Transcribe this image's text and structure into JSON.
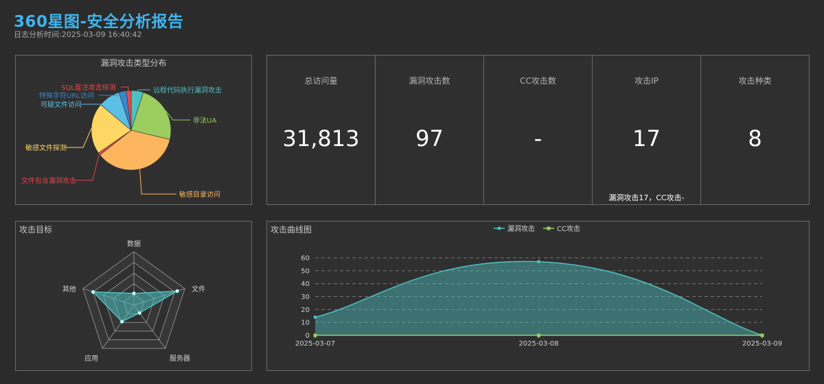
{
  "header": {
    "title": "360星图-安全分析报告",
    "subtitle": "日志分析时间:2025-03-09 16:40:42"
  },
  "pie": {
    "title": "漏洞攻击类型分布",
    "slices": [
      {
        "label": "远程代码执行漏洞攻击",
        "value": 5,
        "color": "#4fc1c1"
      },
      {
        "label": "非法UA",
        "value": 24,
        "color": "#9bcd5f"
      },
      {
        "label": "敏感目录访问",
        "value": 36,
        "color": "#fdb65e"
      },
      {
        "label": "文件包含漏洞攻击",
        "value": 1,
        "color": "#e0434f"
      },
      {
        "label": "敏感文件探测",
        "value": 21,
        "color": "#fdd664"
      },
      {
        "label": "可疑文件访问",
        "value": 9,
        "color": "#5cbfe5"
      },
      {
        "label": "特殊字符URL访问",
        "value": 3,
        "color": "#3a86c8"
      },
      {
        "label": "SQL盲注攻击探测",
        "value": 2,
        "color": "#e54b4b"
      }
    ]
  },
  "stats": [
    {
      "label": "总访问量",
      "value": "31,813",
      "note": ""
    },
    {
      "label": "漏洞攻击数",
      "value": "97",
      "note": ""
    },
    {
      "label": "CC攻击数",
      "value": "-",
      "note": ""
    },
    {
      "label": "攻击IP",
      "value": "17",
      "note": "漏洞攻击17，CC攻击-"
    },
    {
      "label": "攻击种类",
      "value": "8",
      "note": ""
    }
  ],
  "radar": {
    "title": "攻击目标",
    "indicators": [
      "数据",
      "文件",
      "服务器",
      "应用",
      "其他"
    ],
    "values": [
      0.22,
      0.85,
      0.18,
      0.38,
      0.8
    ],
    "color": "#4fc1c1"
  },
  "line": {
    "title": "攻击曲线图",
    "legend": [
      "漏洞攻击",
      "CC攻击"
    ],
    "colors": {
      "vuln": "#4fc1c1",
      "cc": "#9bcd5f"
    }
  },
  "chart_data": {
    "type": "area",
    "categories": [
      "2025-03-07",
      "2025-03-08",
      "2025-03-09"
    ],
    "series": [
      {
        "name": "漏洞攻击",
        "values": [
          14,
          57,
          0
        ]
      },
      {
        "name": "CC攻击",
        "values": [
          0,
          0,
          0
        ]
      }
    ],
    "y_ticks": [
      0,
      10,
      20,
      30,
      40,
      50,
      60
    ],
    "ylim": [
      0,
      60
    ],
    "grid": true,
    "legend_position": "top"
  }
}
